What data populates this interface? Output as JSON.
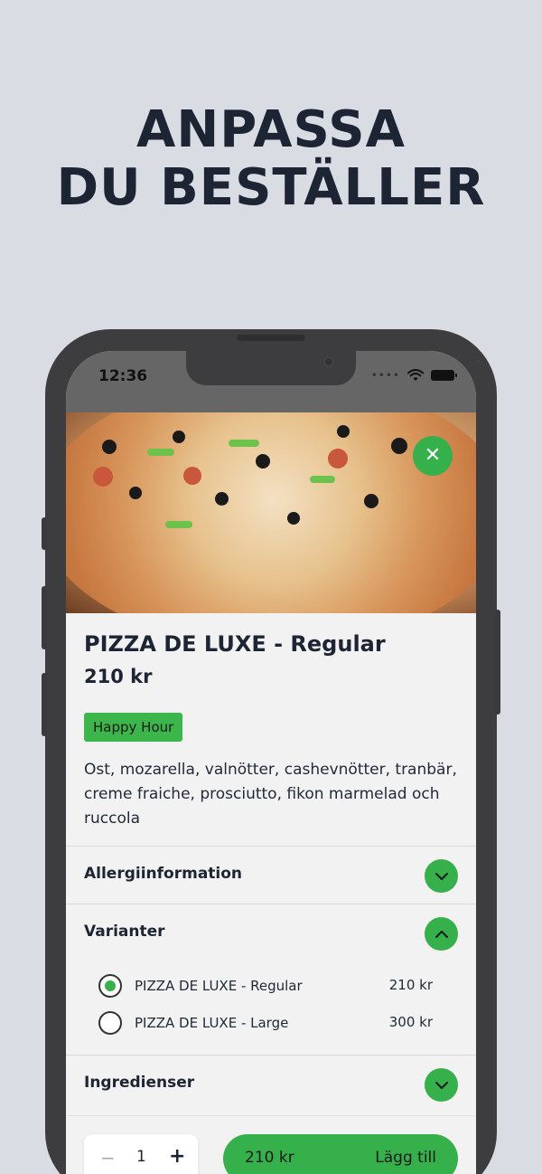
{
  "headline": {
    "line1": "ANPASSA",
    "line2": "DU BESTÄLLER"
  },
  "status": {
    "time": "12:36"
  },
  "product": {
    "name": "PIZZA DE LUXE - Regular",
    "price": "210 kr",
    "badge": "Happy Hour",
    "description": "Ost, mozarella, valnötter, cashevnötter, tranbär, creme fraiche, prosciutto, fikon marmelad och ruccola"
  },
  "sections": {
    "allergy": {
      "title": "Allergiinformation",
      "expanded": false
    },
    "variants": {
      "title": "Varianter",
      "expanded": true,
      "items": [
        {
          "label": "PIZZA DE LUXE - Regular",
          "price": "210 kr",
          "selected": true
        },
        {
          "label": "PIZZA DE LUXE - Large",
          "price": "300 kr",
          "selected": false
        }
      ]
    },
    "ingredients": {
      "title": "Ingredienser",
      "expanded": false
    }
  },
  "footer": {
    "minus": "−",
    "quantity": "1",
    "plus": "+",
    "total": "210 kr",
    "add_label": "Lägg till"
  },
  "icons": {
    "close": "close-icon",
    "chevron_down": "chevron-down-icon",
    "chevron_up": "chevron-up-icon",
    "wifi": "wifi-icon",
    "battery": "battery-icon"
  },
  "colors": {
    "accent": "#35b04a",
    "background": "#d9dce2",
    "headline": "#1d2433"
  }
}
